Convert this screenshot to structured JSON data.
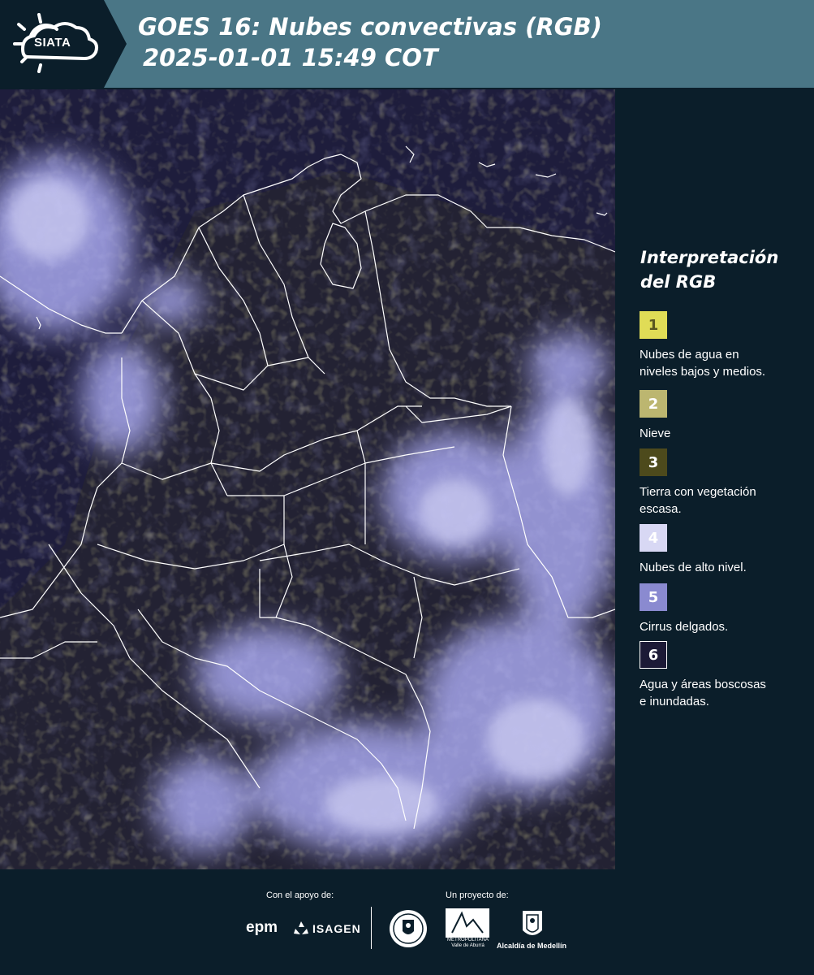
{
  "header": {
    "logo_text": "SIATA",
    "title_line1": "GOES 16: Nubes convectivas (RGB)",
    "title_line2": "2025-01-01 15:49 COT"
  },
  "legend": {
    "title": "Interpretación del RGB",
    "items": [
      {
        "number": "1",
        "color": "#e0dc56",
        "label": "Nubes de agua en\nniveles bajos y medios."
      },
      {
        "number": "2",
        "color": "#bcb670",
        "label": "Nieve"
      },
      {
        "number": "3",
        "color": "#4d4a1c",
        "label": "Tierra con vegetación\nescasa."
      },
      {
        "number": "4",
        "color": "#d8d8f4",
        "label": "Nubes de alto nivel."
      },
      {
        "number": "5",
        "color": "#8a8ad0",
        "label": "Cirrus delgados."
      },
      {
        "number": "6",
        "color": "#1c1a36",
        "label": "Agua y áreas boscosas\ne inundadas."
      }
    ]
  },
  "footer": {
    "support_label": "Con el apoyo de:",
    "project_label": "Un proyecto de:",
    "sponsors": [
      "epm",
      "ISAGEN"
    ],
    "area_text": "METROPOLITANA Valle de Aburrá",
    "alcaldia_text": "Alcaldía de Medellín"
  },
  "colors": {
    "header_bg": "#4a7686",
    "logo_bg": "#0b1e2a",
    "page_bg": "#0b1e2a",
    "map_ocean": "#1e1d3c",
    "border_lines": "#ffffff"
  }
}
